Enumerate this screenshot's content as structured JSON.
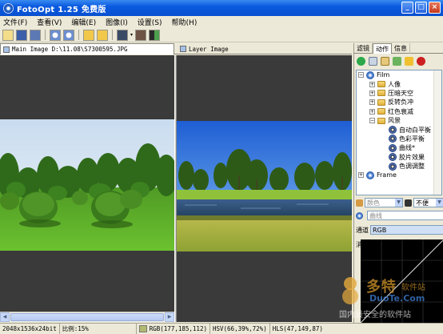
{
  "window": {
    "title": "FotoOpt 1.25 免费版",
    "controls": [
      "_",
      "□",
      "×"
    ]
  },
  "menu": [
    {
      "label": "文件(F)"
    },
    {
      "label": "查看(V)"
    },
    {
      "label": "编辑(E)"
    },
    {
      "label": "图像(I)"
    },
    {
      "label": "设置(S)"
    },
    {
      "label": "帮助(H)"
    }
  ],
  "toolbar": {
    "icons": [
      "open-icon",
      "save-icon",
      "save-as-icon",
      "zoom-in-icon",
      "zoom-out-icon",
      "undo-icon",
      "redo-icon",
      "view-mode-icon",
      "portrait-icon",
      "compare-icon"
    ]
  },
  "doc_tabs": {
    "main": "Main Image D:\\11.08\\S7300595.JPG",
    "layer": "Layer Image"
  },
  "right_panel": {
    "tabs": [
      "滤镜",
      "动作",
      "信息"
    ],
    "active_tab": "动作",
    "tree": [
      {
        "label": "Film",
        "level": 1,
        "expander": "−",
        "icon": "globe"
      },
      {
        "label": "人像",
        "level": 2,
        "expander": "+",
        "icon": "folder"
      },
      {
        "label": "压暗天空",
        "level": 2,
        "expander": "+",
        "icon": "folder"
      },
      {
        "label": "反转负冲",
        "level": 2,
        "expander": "+",
        "icon": "folder"
      },
      {
        "label": "红色衰减",
        "level": 2,
        "expander": "+",
        "icon": "folder"
      },
      {
        "label": "风景",
        "level": 2,
        "expander": "−",
        "icon": "folder"
      },
      {
        "label": "自动白平衡",
        "level": 3,
        "icon": "action"
      },
      {
        "label": "色彩平衡",
        "level": 3,
        "icon": "action"
      },
      {
        "label": "曲线*",
        "level": 3,
        "icon": "action"
      },
      {
        "label": "胶片效果",
        "level": 3,
        "icon": "action"
      },
      {
        "label": "色调调整",
        "level": 3,
        "icon": "action"
      },
      {
        "label": "Frame",
        "level": 1,
        "expander": "+",
        "icon": "globe"
      }
    ],
    "color_combo": "颜色",
    "blend_combo": "不便",
    "curve_combo": "曲线",
    "channel_label": "通道",
    "channel_value": "RGB",
    "smooth_label": "消逗",
    "smooth_value": "0"
  },
  "statusbar": {
    "size": "2048x1536x24bit",
    "zoom": "比例:15%",
    "rgb": "RGB(177,185,112)",
    "hsv": "HSV(66,39%,72%)",
    "hls": "HLS(47,149,87)",
    "swatch_color": "#b1b970"
  },
  "watermark": {
    "brand": "多特",
    "suffix": "软件站",
    "url": "DuoTe.Com",
    "caption": "国内最安全的软件站"
  }
}
